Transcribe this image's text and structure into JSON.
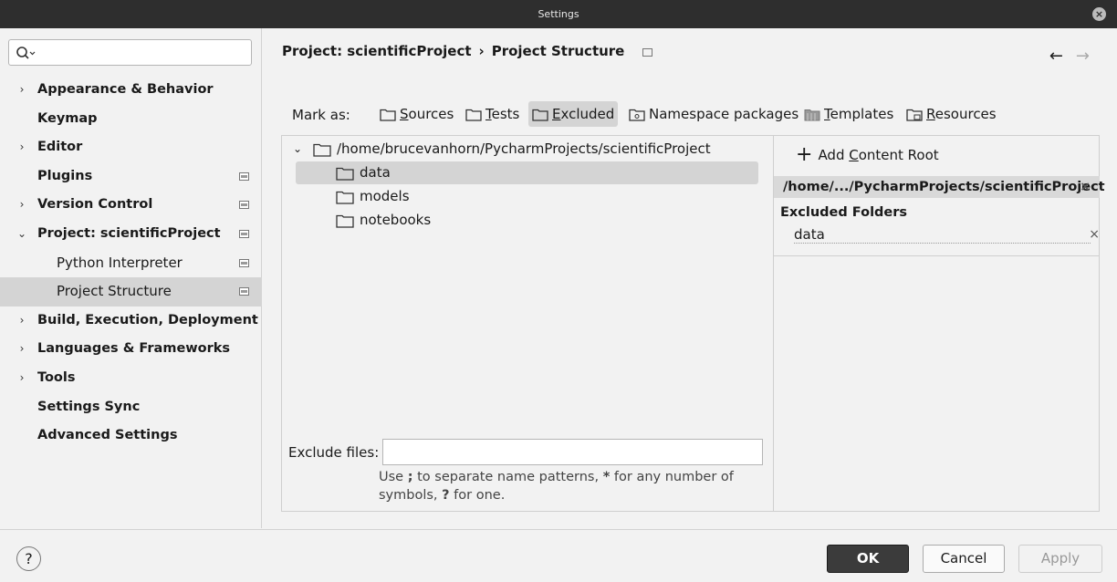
{
  "window": {
    "title": "Settings",
    "close": "×"
  },
  "search": {
    "placeholder": "",
    "value": ""
  },
  "sidebar": {
    "items": [
      {
        "label": "Appearance & Behavior",
        "chevron": "›"
      },
      {
        "label": "Keymap"
      },
      {
        "label": "Editor",
        "chevron": "›"
      },
      {
        "label": "Plugins"
      },
      {
        "label": "Version Control",
        "chevron": "›"
      },
      {
        "label": "Project: scientificProject",
        "chevron": "⌄"
      },
      {
        "label": "Python Interpreter"
      },
      {
        "label": "Project Structure"
      },
      {
        "label": "Build, Execution, Deployment",
        "chevron": "›"
      },
      {
        "label": "Languages & Frameworks",
        "chevron": "›"
      },
      {
        "label": "Tools",
        "chevron": "›"
      },
      {
        "label": "Settings Sync"
      },
      {
        "label": "Advanced Settings"
      }
    ]
  },
  "breadcrumb": {
    "parent": "Project: scientificProject",
    "separator": "›",
    "current": "Project Structure"
  },
  "nav_arrows": {
    "back": "←",
    "forward": "→"
  },
  "mark_as": {
    "label": "Mark as:",
    "buttons": [
      {
        "pre": "",
        "key": "S",
        "post": "ources",
        "icon": "folder-icon"
      },
      {
        "pre": "",
        "key": "T",
        "post": "ests",
        "icon": "test-folder-icon"
      },
      {
        "pre": "",
        "key": "E",
        "post": "xcluded",
        "icon": "excluded-folder-icon",
        "active": true
      },
      {
        "pre": "Namespace packages",
        "key": "",
        "post": "",
        "icon": "namespace-folder-icon"
      },
      {
        "pre": "",
        "key": "T",
        "post": "emplates",
        "icon": "templates-folder-icon"
      },
      {
        "pre": "",
        "key": "R",
        "post": "esources",
        "icon": "resources-folder-icon"
      }
    ]
  },
  "tree": {
    "root": "/home/brucevanhorn/PycharmProjects/scientificProject",
    "root_chevron": "⌄",
    "children": [
      "data",
      "models",
      "notebooks"
    ]
  },
  "exclude_files": {
    "label": "Exclude files:",
    "value": "",
    "hint_1": "Use ",
    "hint_semi": ";",
    "hint_2": " to separate name patterns, ",
    "hint_star": "*",
    "hint_3": " for any number of symbols, ",
    "hint_q": "?",
    "hint_4": " for one."
  },
  "content_root": {
    "add_label_pre": "Add ",
    "add_label_key": "C",
    "add_label_post": "ontent Root",
    "plus": "+",
    "path": "/home/.../PycharmProjects/scientificProject",
    "remove": "×",
    "excluded_heading": "Excluded Folders",
    "excluded": [
      "data"
    ]
  },
  "footer": {
    "help": "?",
    "ok": "OK",
    "cancel": "Cancel",
    "apply": "Apply"
  }
}
